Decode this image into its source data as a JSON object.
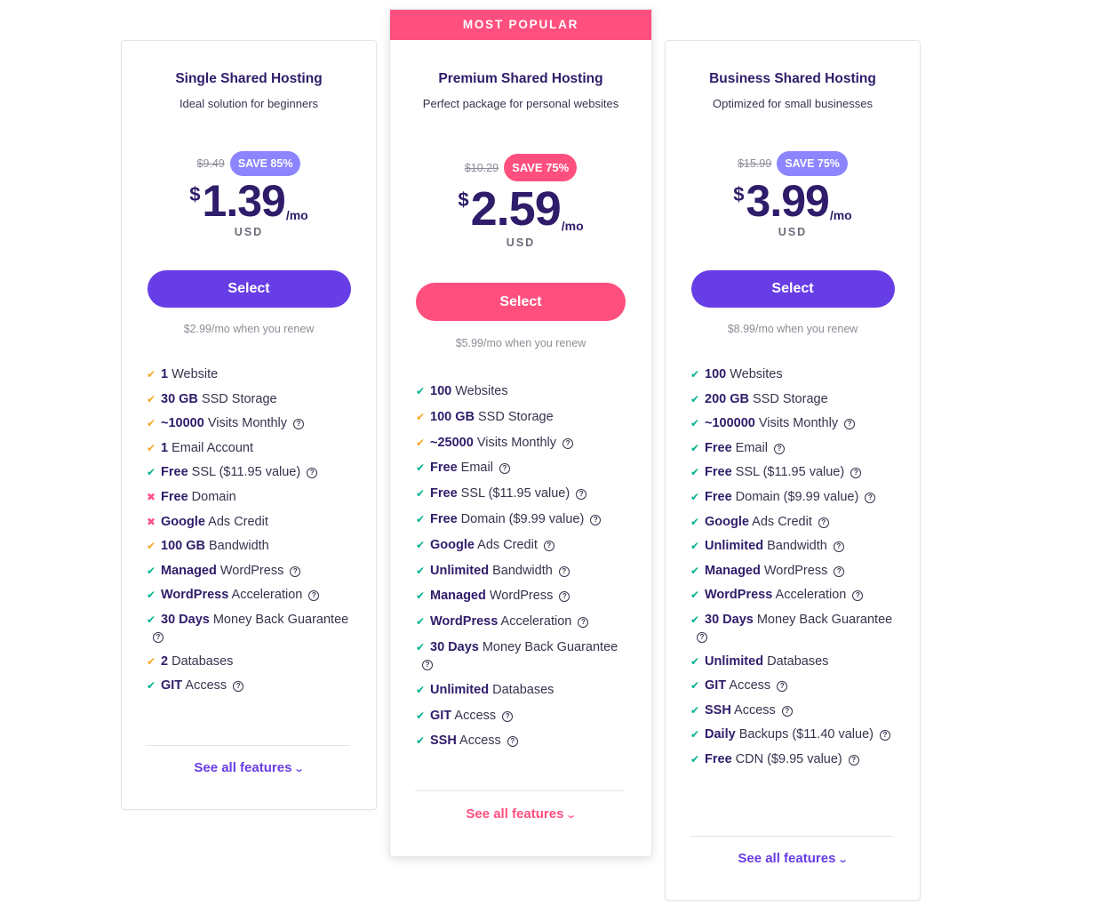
{
  "plans": [
    {
      "name": "Single Shared Hosting",
      "subtitle": "Ideal solution for beginners",
      "old_price": "$9.49",
      "badge": "SAVE 85%",
      "currency": "$",
      "price": "1.39",
      "per": "/mo",
      "currency_code": "USD",
      "select_label": "Select",
      "renew": "$2.99/mo when you renew",
      "see_all": "See all features",
      "features": [
        {
          "status": "partial",
          "bold": "1",
          "text": " Website",
          "help": false
        },
        {
          "status": "partial",
          "bold": "30 GB",
          "text": " SSD Storage",
          "help": false
        },
        {
          "status": "partial",
          "bold": "~10000",
          "text": " Visits Monthly",
          "help": true
        },
        {
          "status": "partial",
          "bold": "1",
          "text": " Email Account",
          "help": false
        },
        {
          "status": "included",
          "bold": "Free",
          "text": " SSL ($11.95 value)",
          "help": true
        },
        {
          "status": "excluded",
          "bold": "Free",
          "text": " Domain",
          "help": false
        },
        {
          "status": "excluded",
          "bold": "Google",
          "text": " Ads Credit",
          "help": false
        },
        {
          "status": "partial",
          "bold": "100 GB",
          "text": " Bandwidth",
          "help": false
        },
        {
          "status": "included",
          "bold": "Managed",
          "text": " WordPress",
          "help": true
        },
        {
          "status": "included",
          "bold": "WordPress",
          "text": " Acceleration",
          "help": true
        },
        {
          "status": "included",
          "bold": "30 Days",
          "text": " Money Back Guarantee",
          "help": true
        },
        {
          "status": "partial",
          "bold": "2",
          "text": " Databases",
          "help": false
        },
        {
          "status": "included",
          "bold": "GIT",
          "text": " Access",
          "help": true
        }
      ]
    },
    {
      "ribbon": "MOST POPULAR",
      "name": "Premium Shared Hosting",
      "subtitle": "Perfect package for personal websites",
      "old_price": "$10.29",
      "badge": "SAVE 75%",
      "currency": "$",
      "price": "2.59",
      "per": "/mo",
      "currency_code": "USD",
      "select_label": "Select",
      "renew": "$5.99/mo when you renew",
      "see_all": "See all features",
      "features": [
        {
          "status": "included",
          "bold": "100",
          "text": " Websites",
          "help": false
        },
        {
          "status": "partial",
          "bold": "100 GB",
          "text": " SSD Storage",
          "help": false
        },
        {
          "status": "partial",
          "bold": "~25000",
          "text": " Visits Monthly",
          "help": true
        },
        {
          "status": "included",
          "bold": "Free",
          "text": " Email",
          "help": true
        },
        {
          "status": "included",
          "bold": "Free",
          "text": " SSL ($11.95 value)",
          "help": true
        },
        {
          "status": "included",
          "bold": "Free",
          "text": " Domain ($9.99 value)",
          "help": true
        },
        {
          "status": "included",
          "bold": "Google",
          "text": " Ads Credit",
          "help": true
        },
        {
          "status": "included",
          "bold": "Unlimited",
          "text": " Bandwidth",
          "help": true
        },
        {
          "status": "included",
          "bold": "Managed",
          "text": " WordPress",
          "help": true
        },
        {
          "status": "included",
          "bold": "WordPress",
          "text": " Acceleration",
          "help": true
        },
        {
          "status": "included",
          "bold": "30 Days",
          "text": " Money Back Guarantee",
          "help": true
        },
        {
          "status": "included",
          "bold": "Unlimited",
          "text": " Databases",
          "help": false
        },
        {
          "status": "included",
          "bold": "GIT",
          "text": " Access",
          "help": true
        },
        {
          "status": "included",
          "bold": "SSH",
          "text": " Access",
          "help": true
        }
      ]
    },
    {
      "name": "Business Shared Hosting",
      "subtitle": "Optimized for small businesses",
      "old_price": "$15.99",
      "badge": "SAVE 75%",
      "currency": "$",
      "price": "3.99",
      "per": "/mo",
      "currency_code": "USD",
      "select_label": "Select",
      "renew": "$8.99/mo when you renew",
      "see_all": "See all features",
      "features": [
        {
          "status": "included",
          "bold": "100",
          "text": " Websites",
          "help": false
        },
        {
          "status": "included",
          "bold": "200 GB",
          "text": " SSD Storage",
          "help": false
        },
        {
          "status": "included",
          "bold": "~100000",
          "text": " Visits Monthly",
          "help": true
        },
        {
          "status": "included",
          "bold": "Free",
          "text": " Email",
          "help": true
        },
        {
          "status": "included",
          "bold": "Free",
          "text": " SSL ($11.95 value)",
          "help": true
        },
        {
          "status": "included",
          "bold": "Free",
          "text": " Domain ($9.99 value)",
          "help": true
        },
        {
          "status": "included",
          "bold": "Google",
          "text": " Ads Credit",
          "help": true
        },
        {
          "status": "included",
          "bold": "Unlimited",
          "text": " Bandwidth",
          "help": true
        },
        {
          "status": "included",
          "bold": "Managed",
          "text": " WordPress",
          "help": true
        },
        {
          "status": "included",
          "bold": "WordPress",
          "text": " Acceleration",
          "help": true
        },
        {
          "status": "included",
          "bold": "30 Days",
          "text": " Money Back Guarantee",
          "help": true
        },
        {
          "status": "included",
          "bold": "Unlimited",
          "text": " Databases",
          "help": false
        },
        {
          "status": "included",
          "bold": "GIT",
          "text": " Access",
          "help": true
        },
        {
          "status": "included",
          "bold": "SSH",
          "text": " Access",
          "help": true
        },
        {
          "status": "included",
          "bold": "Daily",
          "text": " Backups ($11.40 value)",
          "help": true
        },
        {
          "status": "included",
          "bold": "Free",
          "text": " CDN ($9.95 value)",
          "help": true
        }
      ]
    }
  ],
  "icons": {
    "included": "check-icon",
    "partial": "check-icon",
    "excluded": "cross-icon",
    "help": "question-circle-icon",
    "see_all": "chevron-down-icon"
  },
  "colors": {
    "brand_purple": "#673de6",
    "brand_pink": "#ff4f7e",
    "badge_purple": "#8c85ff",
    "heading": "#2f1c6a",
    "check_green": "#00b090",
    "check_orange": "#f5a623",
    "cross_red": "#fc5185"
  }
}
